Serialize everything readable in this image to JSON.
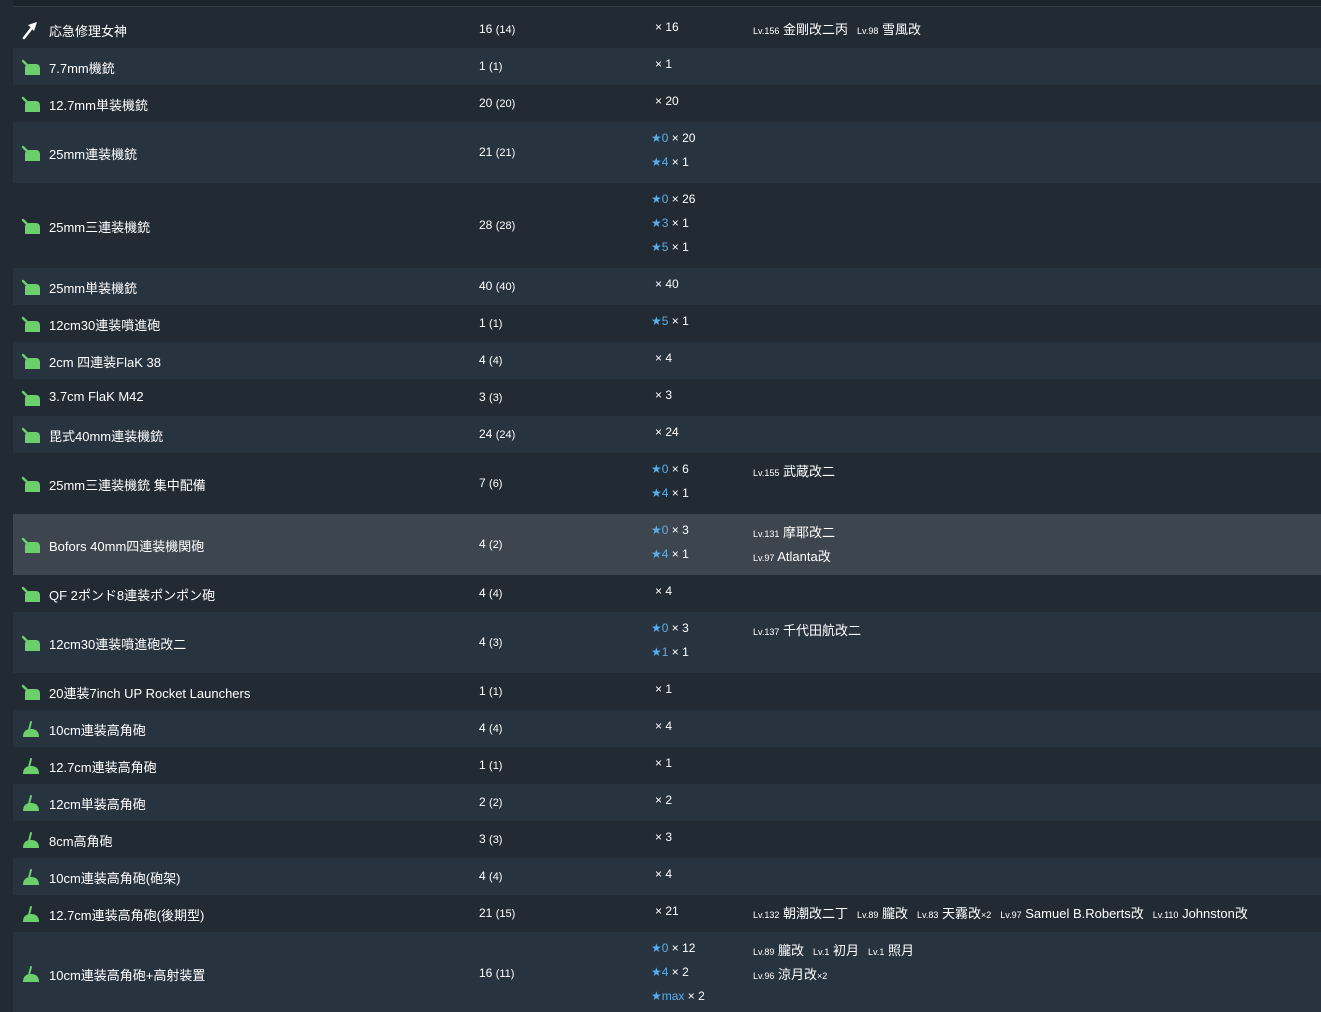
{
  "rows": [
    {
      "icon": "repair-goddess-icon",
      "name": "応急修理女神",
      "total": "16",
      "available": "(14)",
      "upgrades": [
        {
          "star": "",
          "count": "× 16"
        }
      ],
      "ship_lines": [
        [
          {
            "lv": "Lv.156",
            "ship": "金剛改二丙"
          },
          {
            "lv": "Lv.98",
            "ship": "雪風改"
          }
        ]
      ]
    },
    {
      "icon": "aa-gun-icon",
      "name": "7.7mm機銃",
      "total": "1",
      "available": "(1)",
      "upgrades": [
        {
          "star": "",
          "count": "× 1"
        }
      ],
      "ship_lines": []
    },
    {
      "icon": "aa-gun-icon",
      "name": "12.7mm単装機銃",
      "total": "20",
      "available": "(20)",
      "upgrades": [
        {
          "star": "",
          "count": "× 20"
        }
      ],
      "ship_lines": []
    },
    {
      "icon": "aa-gun-icon",
      "name": "25mm連装機銃",
      "total": "21",
      "available": "(21)",
      "upgrades": [
        {
          "star": "★0",
          "count": "× 20"
        },
        {
          "star": "★4",
          "count": "× 1"
        }
      ],
      "ship_lines": []
    },
    {
      "icon": "aa-gun-icon",
      "name": "25mm三連装機銃",
      "total": "28",
      "available": "(28)",
      "upgrades": [
        {
          "star": "★0",
          "count": "× 26"
        },
        {
          "star": "★3",
          "count": "× 1"
        },
        {
          "star": "★5",
          "count": "× 1"
        }
      ],
      "ship_lines": []
    },
    {
      "icon": "aa-gun-icon",
      "name": "25mm単装機銃",
      "total": "40",
      "available": "(40)",
      "upgrades": [
        {
          "star": "",
          "count": "× 40"
        }
      ],
      "ship_lines": []
    },
    {
      "icon": "aa-gun-icon",
      "name": "12cm30連装噴進砲",
      "total": "1",
      "available": "(1)",
      "upgrades": [
        {
          "star": "★5",
          "count": "× 1"
        }
      ],
      "ship_lines": []
    },
    {
      "icon": "aa-gun-icon",
      "name": "2cm 四連装FlaK 38",
      "total": "4",
      "available": "(4)",
      "upgrades": [
        {
          "star": "",
          "count": "× 4"
        }
      ],
      "ship_lines": []
    },
    {
      "icon": "aa-gun-icon",
      "name": "3.7cm FlaK M42",
      "total": "3",
      "available": "(3)",
      "upgrades": [
        {
          "star": "",
          "count": "× 3"
        }
      ],
      "ship_lines": []
    },
    {
      "icon": "aa-gun-icon",
      "name": "毘式40mm連装機銃",
      "total": "24",
      "available": "(24)",
      "upgrades": [
        {
          "star": "",
          "count": "× 24"
        }
      ],
      "ship_lines": []
    },
    {
      "icon": "aa-gun-icon",
      "name": "25mm三連装機銃 集中配備",
      "total": "7",
      "available": "(6)",
      "upgrades": [
        {
          "star": "★0",
          "count": "× 6"
        },
        {
          "star": "★4",
          "count": "× 1"
        }
      ],
      "ship_lines": [
        [
          {
            "lv": "Lv.155",
            "ship": "武蔵改二"
          }
        ]
      ]
    },
    {
      "icon": "aa-gun-icon",
      "name": "Bofors 40mm四連装機関砲",
      "total": "4",
      "available": "(2)",
      "upgrades": [
        {
          "star": "★0",
          "count": "× 3"
        },
        {
          "star": "★4",
          "count": "× 1"
        }
      ],
      "ship_lines": [
        [
          {
            "lv": "Lv.131",
            "ship": "摩耶改二"
          }
        ],
        [
          {
            "lv": "Lv.97",
            "ship": "Atlanta改"
          }
        ]
      ]
    },
    {
      "icon": "aa-gun-icon",
      "name": "QF 2ポンド8連装ポンポン砲",
      "total": "4",
      "available": "(4)",
      "upgrades": [
        {
          "star": "",
          "count": "× 4"
        }
      ],
      "ship_lines": []
    },
    {
      "icon": "aa-gun-icon",
      "name": "12cm30連装噴進砲改二",
      "total": "4",
      "available": "(3)",
      "upgrades": [
        {
          "star": "★0",
          "count": "× 3"
        },
        {
          "star": "★1",
          "count": "× 1"
        }
      ],
      "ship_lines": [
        [
          {
            "lv": "Lv.137",
            "ship": "千代田航改二"
          }
        ]
      ]
    },
    {
      "icon": "aa-gun-icon",
      "name": "20連装7inch UP Rocket Launchers",
      "total": "1",
      "available": "(1)",
      "upgrades": [
        {
          "star": "",
          "count": "× 1"
        }
      ],
      "ship_lines": []
    },
    {
      "icon": "ha-gun-icon",
      "name": "10cm連装高角砲",
      "total": "4",
      "available": "(4)",
      "upgrades": [
        {
          "star": "",
          "count": "× 4"
        }
      ],
      "ship_lines": []
    },
    {
      "icon": "ha-gun-icon",
      "name": "12.7cm連装高角砲",
      "total": "1",
      "available": "(1)",
      "upgrades": [
        {
          "star": "",
          "count": "× 1"
        }
      ],
      "ship_lines": []
    },
    {
      "icon": "ha-gun-icon",
      "name": "12cm単装高角砲",
      "total": "2",
      "available": "(2)",
      "upgrades": [
        {
          "star": "",
          "count": "× 2"
        }
      ],
      "ship_lines": []
    },
    {
      "icon": "ha-gun-icon",
      "name": "8cm高角砲",
      "total": "3",
      "available": "(3)",
      "upgrades": [
        {
          "star": "",
          "count": "× 3"
        }
      ],
      "ship_lines": []
    },
    {
      "icon": "ha-gun-icon",
      "name": "10cm連装高角砲(砲架)",
      "total": "4",
      "available": "(4)",
      "upgrades": [
        {
          "star": "",
          "count": "× 4"
        }
      ],
      "ship_lines": []
    },
    {
      "icon": "ha-gun-icon",
      "name": "12.7cm連装高角砲(後期型)",
      "total": "21",
      "available": "(15)",
      "upgrades": [
        {
          "star": "",
          "count": "× 21"
        }
      ],
      "ship_lines": [
        [
          {
            "lv": "Lv.132",
            "ship": "朝潮改二丁"
          },
          {
            "lv": "Lv.89",
            "ship": "朧改"
          },
          {
            "lv": "Lv.83",
            "ship": "天霧改",
            "mult": "×2"
          },
          {
            "lv": "Lv.97",
            "ship": "Samuel B.Roberts改"
          },
          {
            "lv": "Lv.110",
            "ship": "Johnston改"
          }
        ]
      ]
    },
    {
      "icon": "ha-gun-icon",
      "name": "10cm連装高角砲+高射装置",
      "total": "16",
      "available": "(11)",
      "upgrades": [
        {
          "star": "★0",
          "count": "× 12"
        },
        {
          "star": "★4",
          "count": "× 2"
        },
        {
          "star": "★max",
          "count": "× 2"
        }
      ],
      "ship_lines": [
        [
          {
            "lv": "Lv.89",
            "ship": "朧改"
          },
          {
            "lv": "Lv.1",
            "ship": "初月"
          },
          {
            "lv": "Lv.1",
            "ship": "照月"
          }
        ],
        [
          {
            "lv": "Lv.96",
            "ship": "涼月改",
            "mult": "×2"
          }
        ]
      ]
    }
  ],
  "colors": {
    "accent_star": "#5aaee9",
    "icon_green": "#6bcf6b",
    "row_odd": "#222b34",
    "row_even": "#283340",
    "row_hover": "#3d454f"
  }
}
